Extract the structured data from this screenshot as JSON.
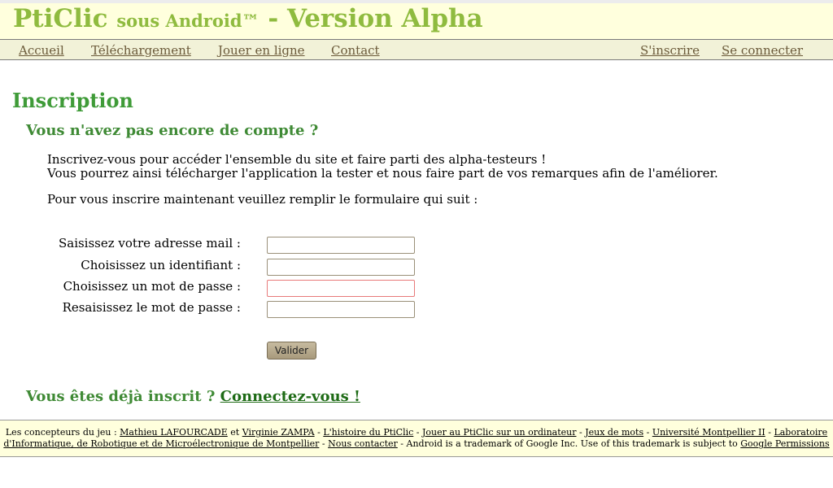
{
  "header": {
    "title_main": "PtiClic",
    "title_small": "sous Android™",
    "title_version": "- Version Alpha"
  },
  "menu": {
    "items": [
      {
        "label": "Accueil"
      },
      {
        "label": "Téléchargement"
      },
      {
        "label": "Jouer en ligne"
      },
      {
        "label": "Contact"
      }
    ],
    "signup": "S'inscrire",
    "login": "Se connecter"
  },
  "main": {
    "heading": "Inscription",
    "no_account_heading": "Vous n'avez pas encore de compte ?",
    "intro_line1": "Inscrivez-vous pour accéder l'ensemble du site et faire parti des alpha-testeurs !",
    "intro_line2": "Vous pourrez ainsi télécharger l'application la tester et nous faire part de vos remarques afin de l'améliorer.",
    "intro_line3": "Pour vous inscrire maintenant veuillez remplir le formulaire qui suit :",
    "form": {
      "email_label": "Saisissez votre adresse mail :",
      "email_value": "",
      "username_label": "Choisissez un identifiant :",
      "username_value": "",
      "password_label": "Choisissez un mot de passe :",
      "password_value": "",
      "password_confirm_label": "Resaisissez le mot de passe :",
      "password_confirm_value": "",
      "submit_label": "Valider"
    },
    "already_registered": "Vous êtes déjà inscrit ?",
    "login_link": "Connectez-vous !"
  },
  "footer": {
    "designers_prefix": "Les concepteurs du jeu :",
    "designer1": "Mathieu LAFOURCADE",
    "and_word": "et",
    "designer2": "Virginie ZAMPA",
    "sep": "-",
    "link_history": "L'histoire du PtiClic",
    "link_play_computer": "Jouer au PtiClic sur un ordinateur",
    "link_word_games": "Jeux de mots",
    "link_university": "Université Montpellier II",
    "link_lab": "Laboratoire d'Informatique, de Robotique et de Microélectronique de Montpellier",
    "link_contact": "Nous contacter",
    "trademark_text": "Android is a trademark of Google Inc. Use of this trademark is subject to",
    "link_permissions": "Google Permissions"
  },
  "colors": {
    "title_green": "#8fbb3f",
    "heading_green": "#3f9b38",
    "header_bg": "#ffffdd",
    "menu_link": "#6b5a3a",
    "focus_border": "#e87a7a"
  }
}
